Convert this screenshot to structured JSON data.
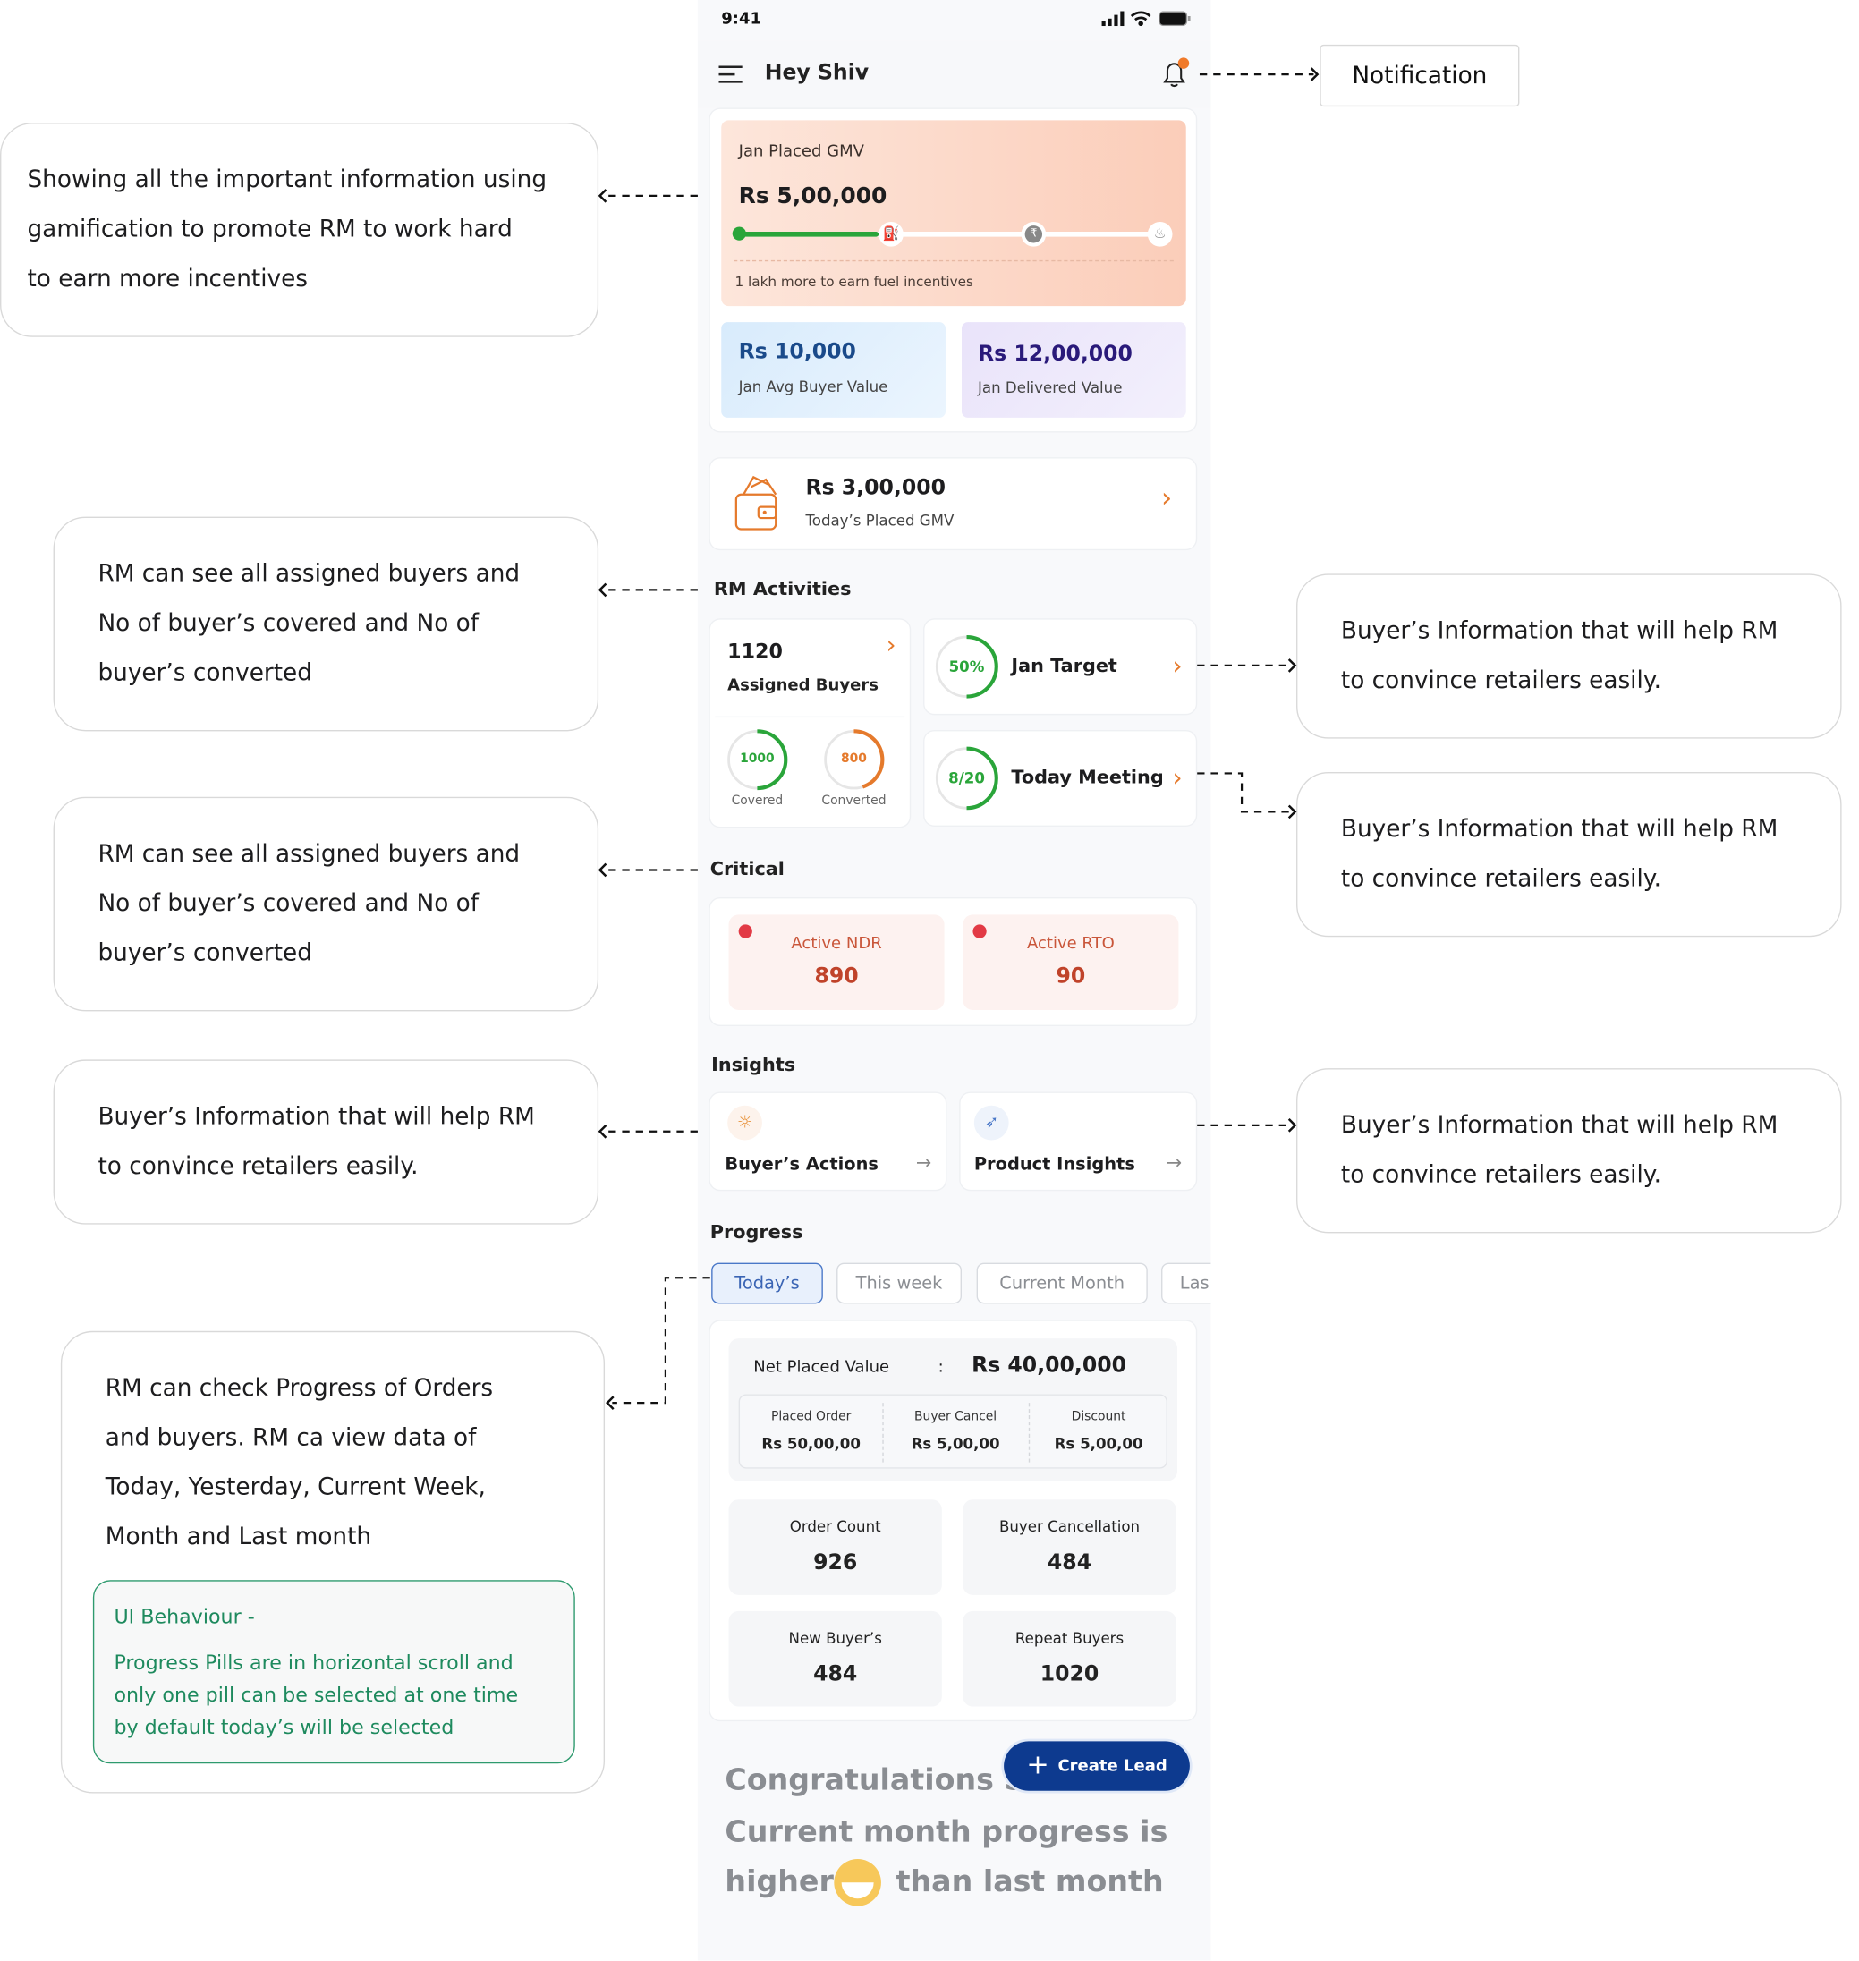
{
  "status_bar": {
    "time": "9:41",
    "icons": [
      "signal-icon",
      "wifi-icon",
      "battery-icon"
    ]
  },
  "header": {
    "greeting": "Hey Shiv",
    "menu_icon": "hamburger-icon",
    "notification_icon": "bell-icon",
    "notification_badge_color": "#f07a2a"
  },
  "gmv_card": {
    "title": "Jan Placed GMV",
    "value": "Rs 5,00,000",
    "progress_milestones": [
      "fuel-icon",
      "rupee-icon",
      "fire-icon"
    ],
    "progress_reached_milestone": 1,
    "hint": "1 lakh more to earn fuel incentives"
  },
  "avg_buyer": {
    "value": "Rs 10,000",
    "label": "Jan Avg Buyer Value"
  },
  "delivered": {
    "value": "Rs 12,00,000",
    "label": "Jan Delivered Value"
  },
  "today_gmv": {
    "value": "Rs 3,00,000",
    "label": "Today’s Placed GMV",
    "icon": "wallet-icon"
  },
  "rm_activities": {
    "title": "RM Activities",
    "assigned": {
      "count": "1120",
      "label": "Assigned Buyers"
    },
    "covered": {
      "value": "1000",
      "label": "Covered",
      "fraction": 0.5
    },
    "converted": {
      "value": "800",
      "label": "Converted",
      "fraction": 0.45
    },
    "jan_target": {
      "value": "50%",
      "label": "Jan Target",
      "fraction": 0.5
    },
    "today_meeting": {
      "value": "8/20",
      "label": "Today Meeting",
      "fraction": 0.5
    }
  },
  "critical": {
    "title": "Critical",
    "items": [
      {
        "label": "Active NDR",
        "value": "890"
      },
      {
        "label": "Active RTO",
        "value": "90"
      }
    ]
  },
  "insights": {
    "title": "Insights",
    "items": [
      {
        "label": "Buyer’s Actions",
        "icon": "lightbulb-icon"
      },
      {
        "label": "Product Insights",
        "icon": "rocket-icon"
      }
    ]
  },
  "progress": {
    "title": "Progress",
    "pills": [
      "Today’s",
      "This week",
      "Current Month",
      "Las"
    ],
    "selected_pill": 0,
    "net_placed": {
      "label": "Net Placed Value",
      "separator": ":",
      "value": "Rs 40,00,000"
    },
    "breakdown": [
      {
        "label": "Placed Order",
        "value": "Rs 50,00,00"
      },
      {
        "label": "Buyer Cancel",
        "value": "Rs 5,00,00"
      },
      {
        "label": "Discount",
        "value": "Rs 5,00,00"
      }
    ],
    "stats": [
      {
        "label": "Order Count",
        "value": "926"
      },
      {
        "label": "Buyer Cancellation",
        "value": "484"
      },
      {
        "label": "New Buyer’s",
        "value": "484"
      },
      {
        "label": "Repeat Buyers",
        "value": "1020"
      }
    ]
  },
  "create_lead": {
    "label": "Create Lead"
  },
  "congrats": {
    "line1": "Congratulations Sh",
    "line2": "Current month progress is",
    "line3a": "higher",
    "line3b": "than  last month"
  },
  "annotations": {
    "notification": "Notification",
    "gamification": [
      "Showing all the important information using",
      "gamification to promote RM to work hard",
      "to earn more incentives"
    ],
    "assigned_1": [
      "RM can see all assigned buyers and",
      "No of buyer’s covered and No of",
      "buyer’s  converted"
    ],
    "assigned_2": [
      "RM can see all assigned buyers and",
      "No of buyer’s covered and No of",
      "buyer’s  converted"
    ],
    "buyer_info_left": [
      "Buyer’s Information that will help RM",
      "to convince retailers easily."
    ],
    "buyer_info_right_1": [
      "Buyer’s Information that will help RM",
      "to convince retailers easily."
    ],
    "buyer_info_right_2": [
      "Buyer’s Information that will help RM",
      "to convince retailers easily."
    ],
    "buyer_info_right_3": [
      "Buyer’s Information that will help RM",
      "to convince retailers easily."
    ],
    "progress_note": [
      "RM can check Progress of Orders",
      "and buyers. RM ca view data of",
      "Today, Yesterday, Current Week,",
      "Month and Last month"
    ],
    "ui_behaviour_title": "UI Behaviour -",
    "ui_behaviour": [
      "Progress Pills are in horizontal scroll and",
      "only one pill can be selected at one time",
      "by default today’s will be selected"
    ]
  },
  "colors": {
    "green": "#2aa53a",
    "orange": "#e57a2c",
    "red": "#e23a45",
    "navy": "#0d3a8f",
    "annotation_green": "#1e8a5e"
  }
}
